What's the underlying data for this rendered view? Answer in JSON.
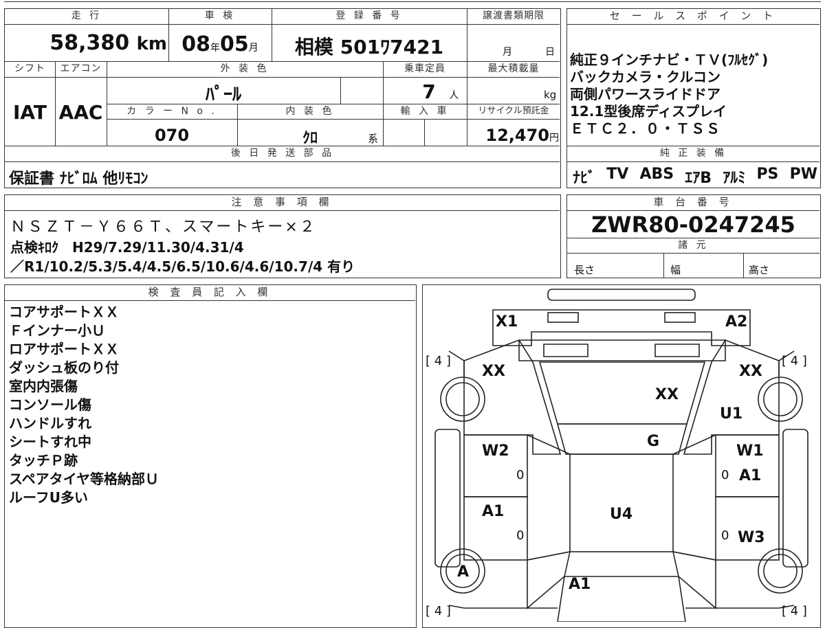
{
  "top_table": {
    "mileage_label": "走 行",
    "mileage_value": "58,380",
    "mileage_unit": "km",
    "inspection_label": "車 検",
    "inspection_year": "08",
    "inspection_year_unit": "年",
    "inspection_month": "05",
    "inspection_month_unit": "月",
    "registration_label": "登 録 番 号",
    "registration_value": "相模 501ﾜ7421",
    "transfer_label": "譲渡書類期限",
    "transfer_month_unit": "月",
    "transfer_day_unit": "日",
    "shift_label": "シフト",
    "shift_value": "IAT",
    "ac_label": "エアコン",
    "ac_value": "AAC",
    "exterior_color_label": "外 装 色",
    "exterior_color_value": "ﾊﾟｰﾙ",
    "capacity_label": "乗車定員",
    "capacity_value": "7",
    "capacity_unit": "人",
    "max_load_label": "最大積載量",
    "max_load_unit": "kg",
    "color_no_label": "カ ラ ー N o .",
    "color_no_value": "070",
    "interior_color_label": "内 装 色",
    "interior_color_value": "ｸﾛ",
    "interior_color_unit": "系",
    "import_label": "輸 入 車",
    "recycle_label": "リサイクル預託金",
    "recycle_value": "12,470",
    "recycle_unit": "円",
    "later_parts_label": "後 日 発 送 部 品",
    "later_parts_value": "保証書 ﾅﾋﾞﾛﾑ 他ﾘﾓｺﾝ"
  },
  "sales_points": {
    "label": "セ ー ル ス ポ イ ン ト",
    "lines": [
      "純正９インチナビ・ＴＶ(ﾌﾙｾｸﾞ)",
      "バックカメラ・クルコン",
      "両側パワースライドドア",
      "12.1型後席ディスプレイ",
      "ＥＴＣ２．０・ＴＳＳ"
    ],
    "equipment_label": "純 正 装 備",
    "equipment_items": [
      "ﾅﾋﾞ",
      "TV",
      "ABS",
      "ｴｱB",
      "ｱﾙﾐ",
      "PS",
      "PW"
    ]
  },
  "notes": {
    "label": "注 意 事 項 欄",
    "lines": [
      "ＮＳＺＴ－Ｙ６６Ｔ、スマートキー×２",
      "点検ｷﾛｸ　H29/7.29/11.30/4.31/4",
      "／R1/10.2/5.3/5.4/4.5/6.5/10.6/4.6/10.7/4 有り"
    ]
  },
  "chassis": {
    "label": "車 台 番 号",
    "value": "ZWR80-0247245",
    "specs_label": "諸 元",
    "length_label": "長さ",
    "width_label": "幅",
    "height_label": "高さ"
  },
  "inspector": {
    "label": "検 査 員 記 入 欄",
    "lines": [
      "コアサポートＸＸ",
      "Ｆインナー小Ｕ",
      "ロアサポートＸＸ",
      "ダッシュ板のり付",
      "室内内張傷",
      "コンソール傷",
      "ハンドルすれ",
      "シートすれ中",
      "タッチＰ跡",
      "スペアタイヤ等格納部Ｕ",
      "ルーフU多い"
    ]
  },
  "diagram": {
    "tire_fl": "[ 4 ]",
    "tire_fr": "[ 4 ]",
    "tire_rl": "[ 4 ]",
    "tire_rr": "[ 4 ]",
    "mark_x1": "X1",
    "mark_a2": "A2",
    "mark_xx_left": "XX",
    "mark_xx_right": "XX",
    "mark_xx_hood": "XX",
    "mark_u1": "U1",
    "mark_g": "G",
    "mark_w2": "W2",
    "mark_w1": "W1",
    "mark_a1_right": "A1",
    "mark_a1_left": "A1",
    "mark_u4": "U4",
    "mark_w3": "W3",
    "mark_a_wheel": "A",
    "mark_a1_rear": "A1",
    "zero_1": "0",
    "zero_2": "0",
    "zero_3": "0",
    "zero_4": "0"
  }
}
